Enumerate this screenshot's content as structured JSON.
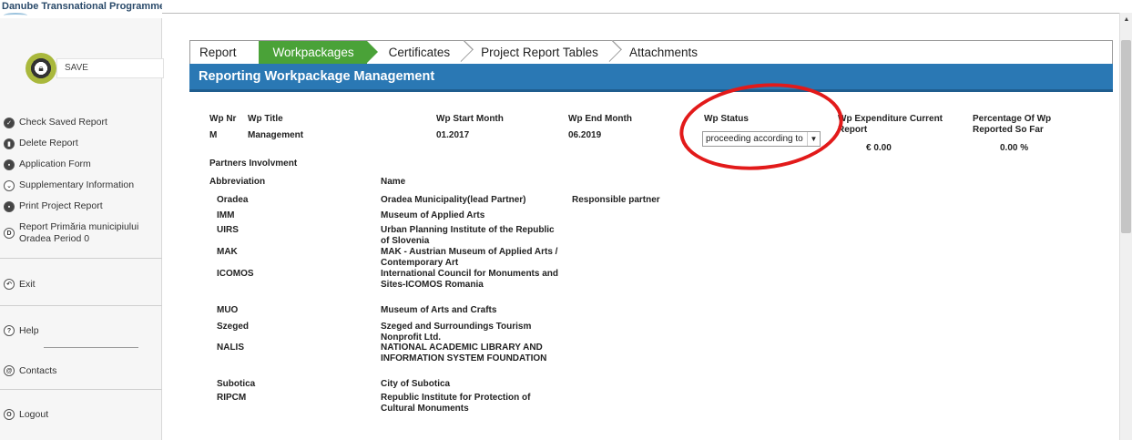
{
  "app": {
    "title": "Danube Transnational Programme"
  },
  "sidebar": {
    "save_label": "SAVE",
    "items": [
      {
        "label": "Check Saved Report",
        "icon": "check-icon"
      },
      {
        "label": "Delete Report",
        "icon": "trash-icon"
      },
      {
        "label": "Application Form",
        "icon": "lock-icon"
      },
      {
        "label": "Supplementary Information",
        "icon": "download-icon"
      },
      {
        "label": "Print Project Report",
        "icon": "lock-icon"
      },
      {
        "label": "Report Primăria municipiului Oradea Period 0",
        "icon": "document-icon"
      }
    ],
    "exit_label": "Exit",
    "help_label": "Help",
    "contacts_label": "Contacts",
    "logout_label": "Logout"
  },
  "tabs": [
    {
      "label": "Report",
      "active": false
    },
    {
      "label": "Workpackages",
      "active": true
    },
    {
      "label": "Certificates",
      "active": false
    },
    {
      "label": "Project Report Tables",
      "active": false
    },
    {
      "label": "Attachments",
      "active": false
    }
  ],
  "section_title": "Reporting Workpackage Management",
  "workpackage": {
    "headers": {
      "nr": "Wp Nr",
      "title": "Wp Title",
      "start": "Wp Start Month",
      "end": "Wp End Month",
      "status": "Wp Status",
      "expenditure": "Wp Expenditure Current Report",
      "percentage": "Percentage Of Wp Reported So Far"
    },
    "values": {
      "nr": "M",
      "title": "Management",
      "start": "01.2017",
      "end": "06.2019",
      "status": "proceeding according to",
      "expenditure": "€ 0.00",
      "percentage": "0.00 %"
    }
  },
  "partners": {
    "label": "Partners Involvment",
    "col_abbr": "Abbreviation",
    "col_name": "Name",
    "rows": [
      {
        "abbr": "Oradea",
        "name": "Oradea Municipality(lead Partner)",
        "role": "Responsible partner"
      },
      {
        "abbr": "IMM",
        "name": "Museum of Applied Arts",
        "role": ""
      },
      {
        "abbr": "UIRS",
        "name": "Urban Planning Institute of the Republic of Slovenia",
        "role": ""
      },
      {
        "abbr": "MAK",
        "name": "MAK - Austrian Museum of Applied Arts / Contemporary Art",
        "role": ""
      },
      {
        "abbr": "ICOMOS",
        "name": "International Council for Monuments and Sites-ICOMOS Romania",
        "role": ""
      },
      {
        "abbr": "MUO",
        "name": "Museum of Arts and Crafts",
        "role": ""
      },
      {
        "abbr": "Szeged",
        "name": "Szeged and Surroundings Tourism Nonprofit Ltd.",
        "role": ""
      },
      {
        "abbr": "NALIS",
        "name": "NATIONAL ACADEMIC LIBRARY AND INFORMATION SYSTEM FOUNDATION",
        "role": ""
      },
      {
        "abbr": "Subotica",
        "name": "City of Subotica",
        "role": ""
      },
      {
        "abbr": "RIPCM",
        "name": "Republic Institute for Protection of Cultural Monuments",
        "role": ""
      }
    ]
  },
  "colors": {
    "tab_active": "#4aa238",
    "header_bar": "#2a78b4",
    "highlight_circle": "#e21a1a"
  }
}
